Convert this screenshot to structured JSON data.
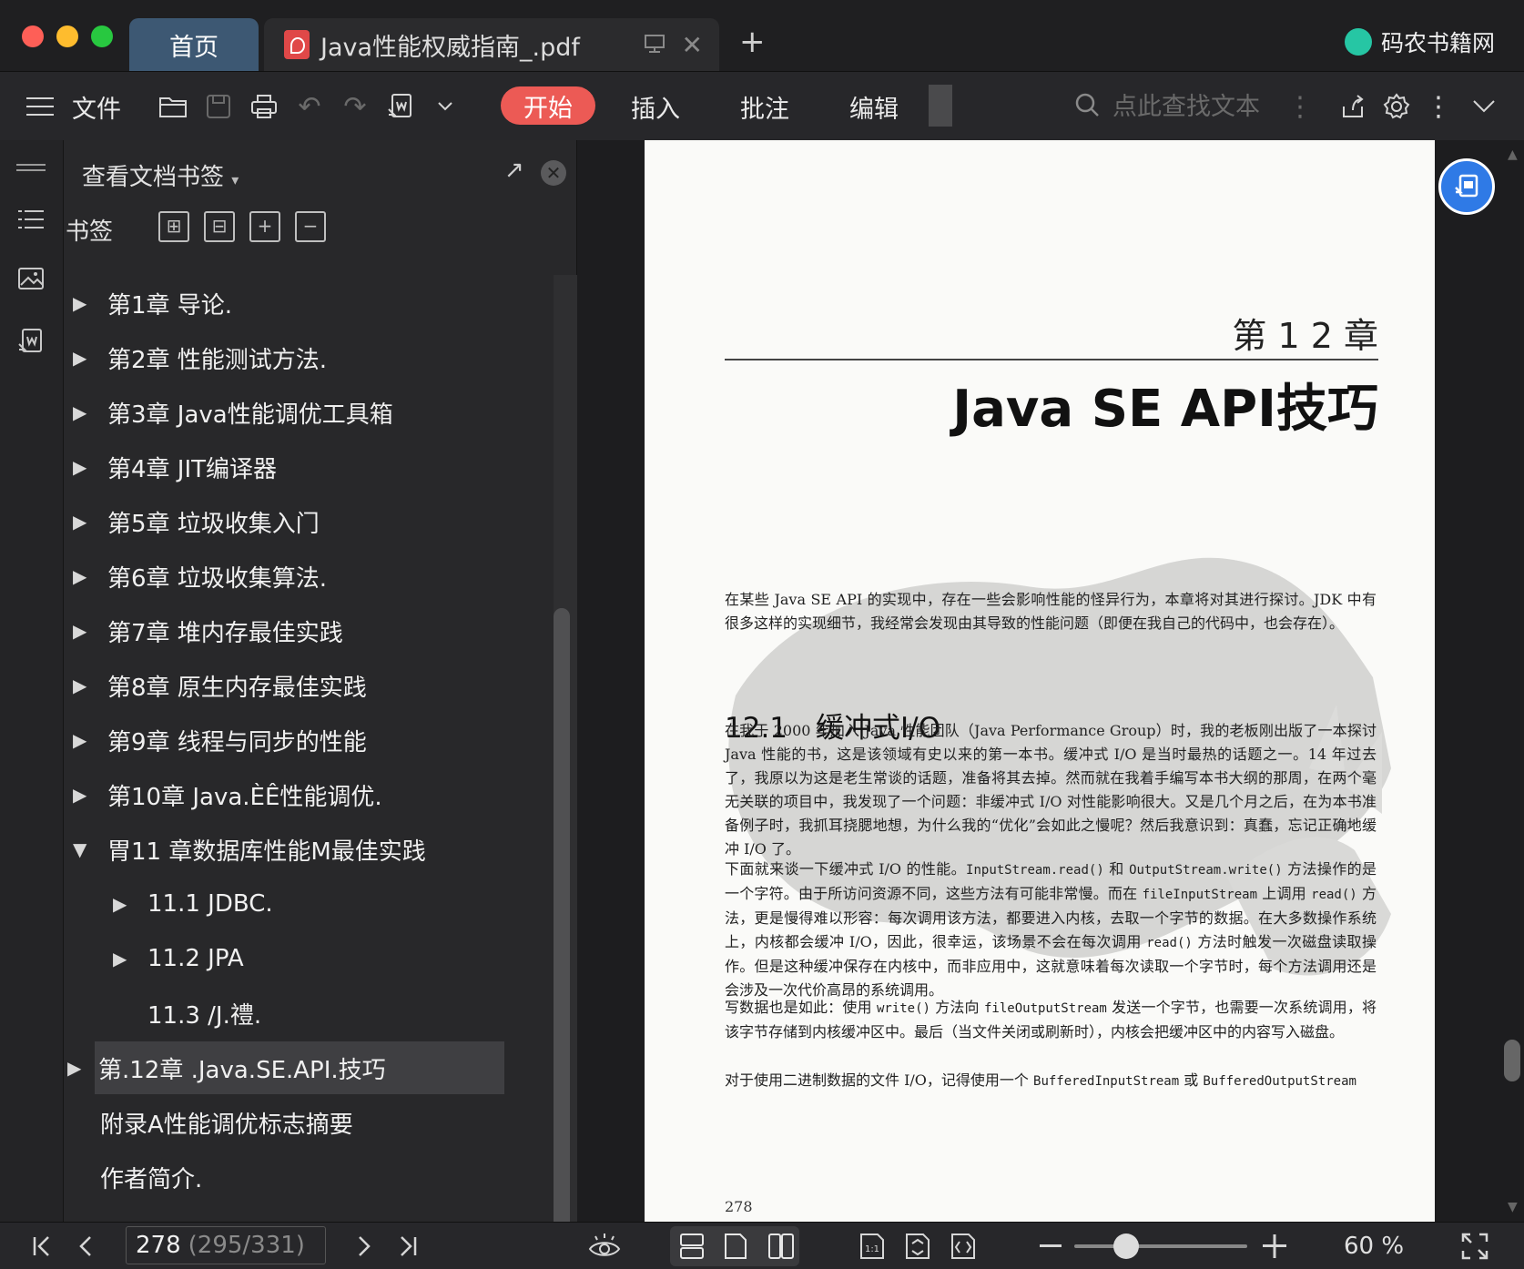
{
  "titlebar": {
    "tabs": [
      {
        "label": "首页"
      },
      {
        "label": "Java性能权威指南_.pdf"
      }
    ],
    "new_tab_label": "+",
    "brand": "码农书籍网"
  },
  "toolbar": {
    "file_label": "文件",
    "menus": [
      "开始",
      "插入",
      "批注",
      "编辑"
    ],
    "search_placeholder": "点此查找文本"
  },
  "panel": {
    "header": "查看文档书签",
    "bookmarks_label": "书签",
    "items": [
      {
        "label": "第1章 导论.",
        "level": 0,
        "expanded": false
      },
      {
        "label": "第2章 性能测试方法.",
        "level": 0,
        "expanded": false
      },
      {
        "label": "第3章 Java性能调优工具箱",
        "level": 0,
        "expanded": false
      },
      {
        "label": "第4章 JIT编译器",
        "level": 0,
        "expanded": false
      },
      {
        "label": "第5章 垃圾收集入门",
        "level": 0,
        "expanded": false
      },
      {
        "label": "第6章 垃圾收集算法.",
        "level": 0,
        "expanded": false
      },
      {
        "label": "第7章 堆内存最佳实践",
        "level": 0,
        "expanded": false
      },
      {
        "label": "第8章 原生内存最佳实践",
        "level": 0,
        "expanded": false
      },
      {
        "label": "第9章 线程与同步的性能",
        "level": 0,
        "expanded": false
      },
      {
        "label": "第10章 Java.ÈÊ性能调优.",
        "level": 0,
        "expanded": false
      },
      {
        "label": "胃11 章数据库性能M最佳实践",
        "level": 0,
        "expanded": true
      },
      {
        "label": "11.1 JDBC.",
        "level": 1,
        "expanded": false
      },
      {
        "label": "11.2 JPA",
        "level": 1,
        "expanded": false
      },
      {
        "label": "11.3 /J.禮.",
        "level": 1,
        "leaf": true
      },
      {
        "label": "第.12章 .Java.SE.API.技巧",
        "level": 0,
        "expanded": false,
        "selected": true
      },
      {
        "label": "附录A性能调优标志摘要",
        "level": 0,
        "leaf": true
      },
      {
        "label": "作者简介.",
        "level": 0,
        "leaf": true
      }
    ]
  },
  "document": {
    "chapter_num": "第 1 2 章",
    "chapter_title": "Java SE API技巧",
    "intro": "在某些 Java SE API 的实现中，存在一些会影响性能的怪异行为，本章将对其进行探讨。JDK 中有很多这样的实现细节，我经常会发现由其导致的性能问题（即便在我自己的代码中，也会存在）。",
    "section_title": "12.1　缓冲式I/O",
    "p1": "在我于 2000 年加入 Java 性能团队（Java Performance Group）时，我的老板刚出版了一本探讨 Java 性能的书，这是该领域有史以来的第一本书。缓冲式 I/O 是当时最热的话题之一。14 年过去了，我原以为这是老生常谈的话题，准备将其去掉。然而就在我着手编写本书大纲的那周，在两个毫无关联的项目中，我发现了一个问题：非缓冲式 I/O 对性能影响很大。又是几个月之后，在为本书准备例子时，我抓耳挠腮地想，为什么我的“优化”会如此之慢呢？然后我意识到：真蠢，忘记正确地缓冲 I/O 了。",
    "p2_a": "下面就来谈一下缓冲式 I/O 的性能。",
    "p2_code1": "InputStream.read()",
    "p2_b": " 和 ",
    "p2_code2": "OutputStream.write()",
    "p2_c": " 方法操作的是一个字符。由于所访问资源不同，这些方法有可能非常慢。而在 ",
    "p2_code3": "fileInputStream",
    "p2_d": " 上调用 ",
    "p2_code4": "read()",
    "p2_e": " 方法，更是慢得难以形容：每次调用该方法，都要进入内核，去取一个字节的数据。在大多数操作系统上，内核都会缓冲 I/O，因此，很幸运，该场景不会在每次调用 ",
    "p2_code5": "read()",
    "p2_f": " 方法时触发一次磁盘读取操作。但是这种缓冲保存在内核中，而非应用中，这就意味着每次读取一个字节时，每个方法调用还是会涉及一次代价高昂的系统调用。",
    "p3_a": "写数据也是如此：使用 ",
    "p3_code1": "write()",
    "p3_b": " 方法向 ",
    "p3_code2": "fileOutputStream",
    "p3_c": " 发送一个字节，也需要一次系统调用，将该字节存储到内核缓冲区中。最后（当文件关闭或刷新时），内核会把缓冲区中的内容写入磁盘。",
    "p4_a": "对于使用二进制数据的文件 I/O，记得使用一个 ",
    "p4_code1": "BufferedInputStream",
    "p4_b": " 或 ",
    "p4_code2": "BufferedOutputStream",
    "page_number": "278"
  },
  "statusbar": {
    "current_page": "278",
    "page_total": "(295/331)",
    "zoom": "60 %",
    "zoom_fraction": 0.3
  },
  "colors": {
    "accent": "#ec5a55",
    "home_tab": "#3d5873",
    "float_button": "#2f7ae6",
    "traffic_red": "#fe5f57",
    "traffic_yellow": "#febc2e",
    "traffic_green": "#28c840"
  },
  "icons": {
    "toolbar": [
      "hamburger-icon",
      "open-folder-icon",
      "save-icon",
      "print-icon",
      "undo-icon",
      "redo-icon",
      "convert-icon",
      "dropdown-icon",
      "search-icon",
      "share-icon",
      "settings-icon",
      "more-icon",
      "collapse-icon"
    ],
    "rail": [
      "panel-toggle-icon",
      "bookmark-list-icon",
      "thumbnail-icon",
      "annotation-icon"
    ]
  }
}
